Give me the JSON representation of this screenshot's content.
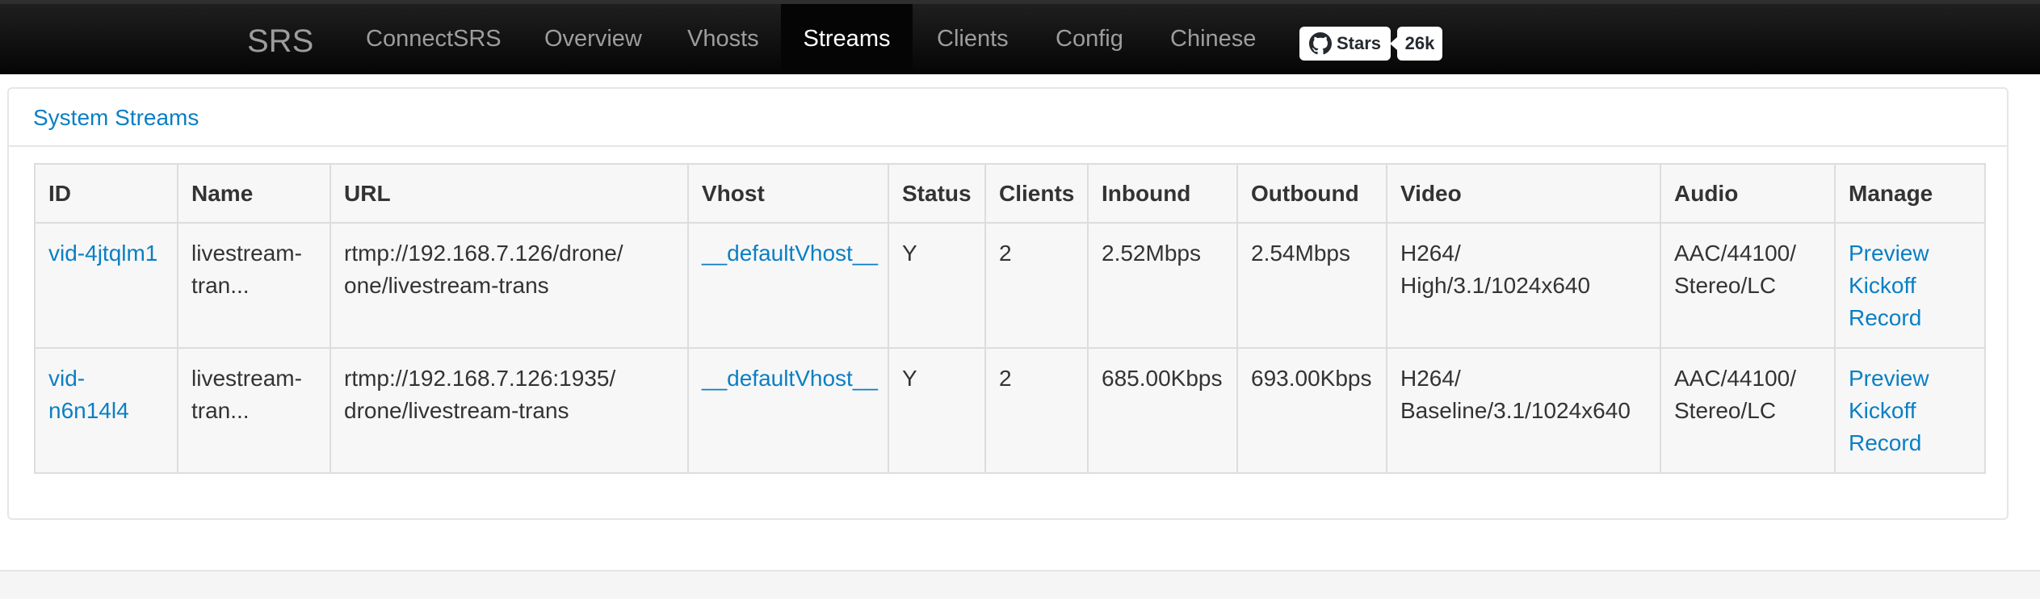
{
  "nav": {
    "brand": "SRS",
    "items": [
      {
        "label": "ConnectSRS"
      },
      {
        "label": "Overview"
      },
      {
        "label": "Vhosts"
      },
      {
        "label": "Streams",
        "active": true
      },
      {
        "label": "Clients"
      },
      {
        "label": "Config"
      },
      {
        "label": "Chinese"
      }
    ],
    "github": {
      "label": "Stars",
      "count": "26k",
      "icon": "github-icon"
    }
  },
  "panel": {
    "title": "System Streams",
    "table": {
      "headers": [
        "ID",
        "Name",
        "URL",
        "Vhost",
        "Status",
        "Clients",
        "Inbound",
        "Outbound",
        "Video",
        "Audio",
        "Manage"
      ],
      "rows": [
        {
          "id": "vid-4jtqlm1",
          "name": [
            "livestream-",
            "tran..."
          ],
          "url": [
            "rtmp://192.168.7.126/drone/",
            "one/livestream-trans"
          ],
          "vhost": "__defaultVhost__",
          "status": "Y",
          "clients": "2",
          "inbound": "2.52Mbps",
          "outbound": "2.54Mbps",
          "video": [
            "H264/",
            "High/3.1/1024x640"
          ],
          "audio": [
            "AAC/44100/",
            "Stereo/LC"
          ],
          "manage": [
            "Preview",
            "Kickoff",
            "Record"
          ]
        },
        {
          "id": [
            "vid-",
            "n6n14l4"
          ],
          "name": [
            "livestream-",
            "tran..."
          ],
          "url": [
            "rtmp://192.168.7.126:1935/",
            "drone/livestream-trans"
          ],
          "vhost": "__defaultVhost__",
          "status": "Y",
          "clients": "2",
          "inbound": "685.00Kbps",
          "outbound": "693.00Kbps",
          "video": [
            "H264/",
            "Baseline/3.1/1024x640"
          ],
          "audio": [
            "AAC/44100/",
            "Stereo/LC"
          ],
          "manage": [
            "Preview",
            "Kickoff",
            "Record"
          ]
        }
      ]
    }
  }
}
